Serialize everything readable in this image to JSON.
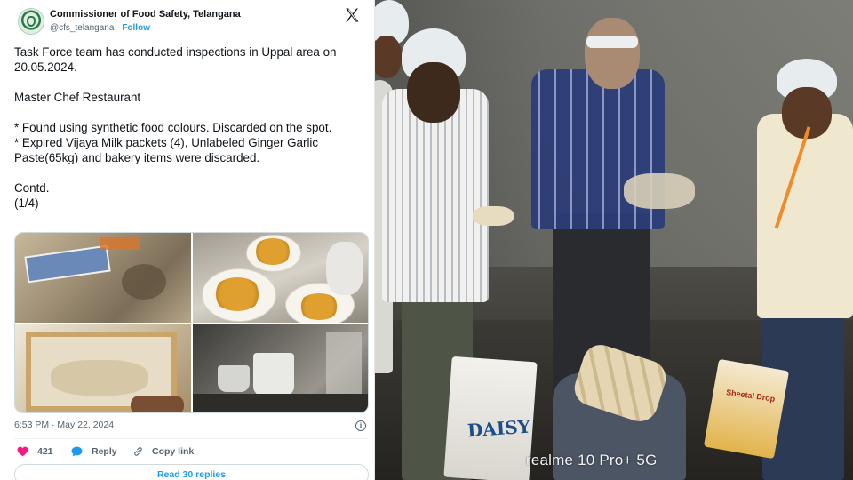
{
  "tweet": {
    "account_name": "Commissioner of Food Safety, Telangana",
    "handle": "@cfs_telangana",
    "separator": " · ",
    "follow_label": "Follow",
    "lines": [
      "Task Force team has conducted inspections in Uppal area on 20.05.2024.",
      "",
      "Master Chef Restaurant",
      "",
      "* Found using synthetic food colours. Discarded on the spot.",
      "* Expired Vijaya Milk packets (4), Unlabeled Ginger Garlic Paste(65kg) and bakery items were discarded.",
      "",
      "Contd.",
      "(1/4)"
    ],
    "timestamp": "6:53 PM · May 22, 2024",
    "like_count": "421",
    "reply_label": "Reply",
    "copy_link_label": "Copy link",
    "read_replies_label": "Read 30 replies"
  },
  "photo": {
    "watermark": "realme 10 Pro+ 5G",
    "bag_brand": "DAISY",
    "box_label": "Sheetal Drop"
  },
  "colors": {
    "accent": "#1d9bf0",
    "like": "#f91880",
    "text_secondary": "#536471"
  },
  "icons": [
    "x-logo-icon",
    "info-icon",
    "heart-icon",
    "reply-icon",
    "link-icon"
  ]
}
